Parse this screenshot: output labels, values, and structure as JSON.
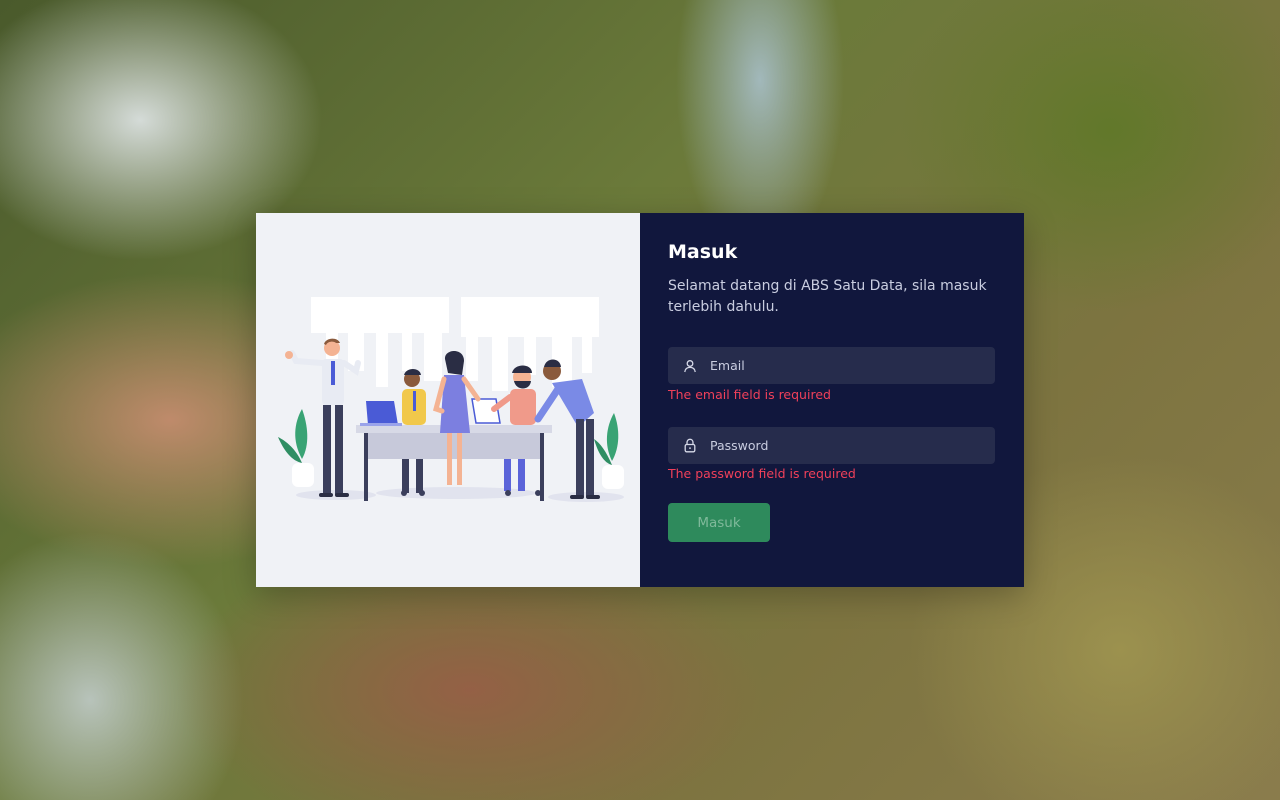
{
  "login": {
    "title": "Masuk",
    "subtitle": "Selamat datang di ABS Satu Data, sila masuk terlebih dahulu.",
    "email": {
      "placeholder": "Email",
      "value": "",
      "icon": "user-icon",
      "error": "The email field is required"
    },
    "password": {
      "placeholder": "Password",
      "value": "",
      "icon": "lock-icon",
      "error": "The password field is required"
    },
    "submit_label": "Masuk"
  },
  "colors": {
    "panel_bg": "#11173d",
    "field_bg": "#262c4c",
    "error": "#f0405a",
    "button_bg": "#2e8a5c",
    "illustration_bg": "#f0f2f6"
  }
}
